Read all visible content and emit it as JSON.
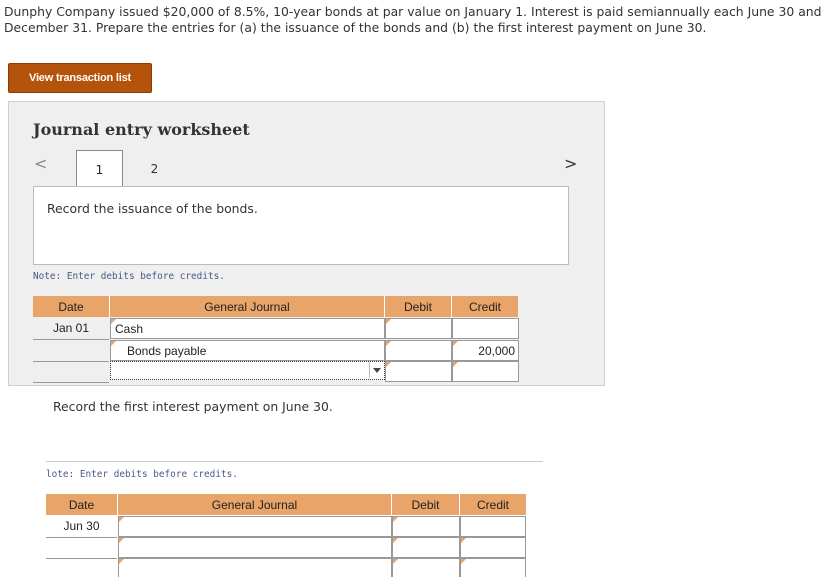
{
  "problem": {
    "text": "Dunphy Company issued $20,000 of 8.5%, 10-year bonds at par value on January 1. Interest is paid semiannually each June 30 and December 31. Prepare the entries for (a) the issuance of the bonds and (b) the first interest payment on June 30."
  },
  "buttons": {
    "view_transaction_list": "View transaction list"
  },
  "worksheet": {
    "title": "Journal entry worksheet",
    "tabs": [
      "1",
      "2"
    ],
    "nav_prev": "<",
    "nav_next": ">",
    "instruction_1": "Record the issuance of the bonds.",
    "note": "Note: Enter debits before credits.",
    "note_2": "lote: Enter debits before credits.",
    "instruction_2": "Record the first interest payment on June 30."
  },
  "journal_headers": {
    "date": "Date",
    "account": "General Journal",
    "debit": "Debit",
    "credit": "Credit"
  },
  "journal_1": {
    "rows": [
      {
        "date": "Jan 01",
        "account": "Cash",
        "debit": "",
        "credit": ""
      },
      {
        "date": "",
        "account": "Bonds payable",
        "debit": "",
        "credit": "20,000"
      },
      {
        "date": "",
        "account": "",
        "debit": "",
        "credit": ""
      }
    ]
  },
  "journal_2": {
    "rows": [
      {
        "date": "Jun 30",
        "account": "",
        "debit": "",
        "credit": ""
      },
      {
        "date": "",
        "account": "",
        "debit": "",
        "credit": ""
      },
      {
        "date": "",
        "account": "",
        "debit": "",
        "credit": ""
      }
    ]
  },
  "colors": {
    "header_orange": "#e8a469",
    "button_brown": "#b4540c"
  }
}
